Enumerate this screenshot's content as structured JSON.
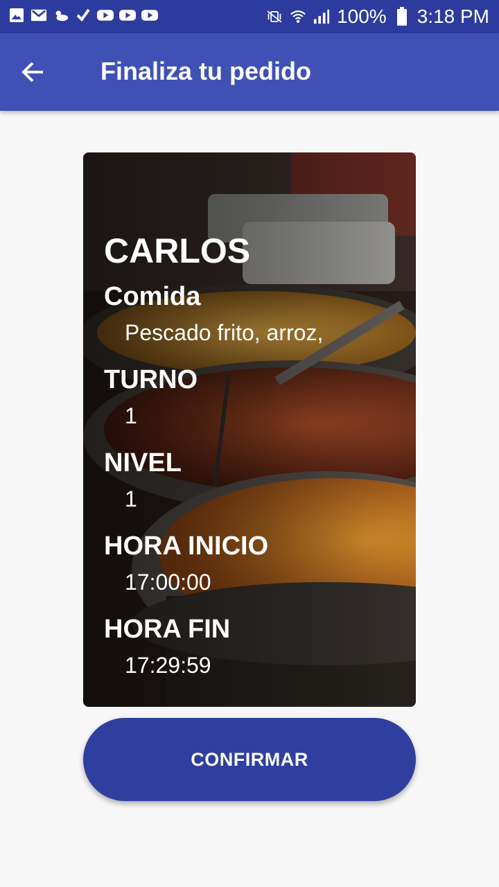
{
  "status_bar": {
    "battery": "100%",
    "time": "3:18 PM",
    "left_icons": [
      "gallery-icon",
      "gmail-icon",
      "weather-icon",
      "checkmark-app-icon",
      "youtube-icon",
      "youtube-icon",
      "youtube-icon"
    ],
    "right_icons": [
      "vibrate-icon",
      "wifi-icon",
      "signal-icon",
      "battery-icon"
    ]
  },
  "app_bar": {
    "title": "Finaliza tu pedido",
    "back_icon": "arrow-back-icon"
  },
  "order": {
    "name": "CARLOS",
    "food_label": "Comida",
    "food_value": "Pescado frito, arroz,",
    "turn_label": "TURNO",
    "turn_value": "1",
    "level_label": "NIVEL",
    "level_value": "1",
    "start_label": "HORA INICIO",
    "start_value": "17:00:00",
    "end_label": "HORA FIN",
    "end_value": "17:29:59"
  },
  "confirm_label": "CONFIRMAR",
  "colors": {
    "status_bar": "#2e3b9e",
    "app_bar": "#3f51b5",
    "button": "#303f9f",
    "background": "#f7f7f8"
  }
}
